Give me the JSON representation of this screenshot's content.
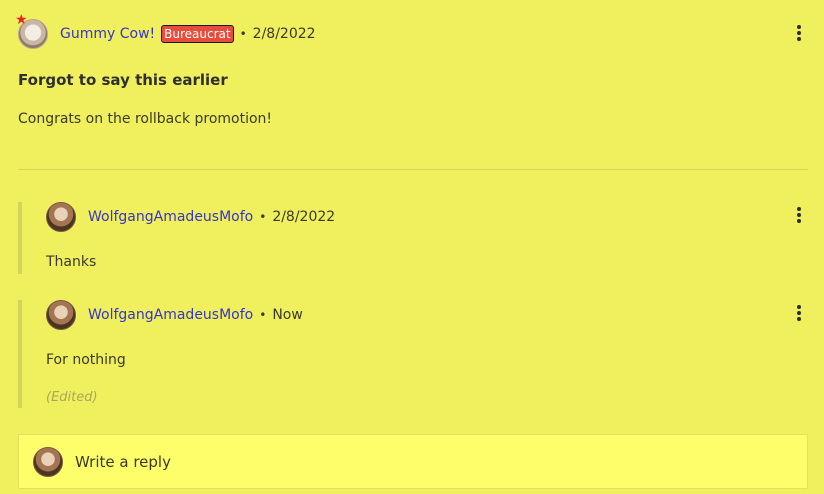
{
  "post": {
    "author": "Gummy Cow!",
    "badge": "Bureaucrat",
    "date": "2/8/2022",
    "title": "Forgot to say this earlier",
    "body": "Congrats on the rollback promotion!"
  },
  "replies": [
    {
      "author": "WolfgangAmadeusMofo",
      "date": "2/8/2022",
      "text": "Thanks",
      "edited": ""
    },
    {
      "author": "WolfgangAmadeusMofo",
      "date": "Now",
      "text": "For nothing",
      "edited": "(Edited)"
    }
  ],
  "composer": {
    "placeholder": "Write a reply"
  },
  "colors": {
    "background": "#f0f05f",
    "username": "#3535c8",
    "badge": "#e74c3c",
    "reply_box": "#fefe6a"
  },
  "icons": {
    "menu": "kebab-menu-icon",
    "admin": "star-icon"
  }
}
